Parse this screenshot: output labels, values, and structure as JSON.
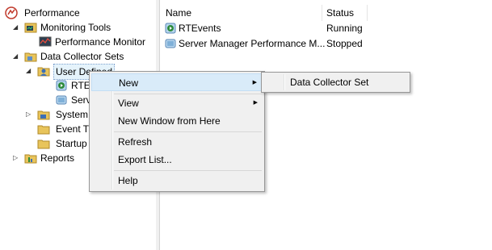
{
  "tree": {
    "performance": "Performance",
    "monitoring_tools": "Monitoring Tools",
    "performance_monitor": "Performance Monitor",
    "data_collector_sets": "Data Collector Sets",
    "user_defined": "User Defined",
    "rtevents_partial": "RTE",
    "server_partial": "Serv",
    "system_partial": "System",
    "event_trace_partial": "Event Tr",
    "startup_partial": "Startup",
    "reports": "Reports"
  },
  "list": {
    "headers": {
      "name": "Name",
      "status": "Status"
    },
    "rows": [
      {
        "name": "RTEvents",
        "status": "Running"
      },
      {
        "name": "Server Manager Performance M...",
        "status": "Stopped"
      }
    ]
  },
  "context_menu": {
    "new": "New",
    "view": "View",
    "new_window": "New Window from Here",
    "refresh": "Refresh",
    "export_list": "Export List...",
    "help": "Help"
  },
  "submenu": {
    "data_collector_set": "Data Collector Set"
  },
  "colors": {
    "highlight": "#d9ebf9",
    "selection": "#e5f3fb",
    "folder": "#e8c45b"
  },
  "icons": {
    "performance": "performance-icon",
    "monitoring": "monitoring-tools-icon",
    "monitor": "performance-monitor-icon",
    "folder": "folder-icon",
    "user": "user-defined-icon",
    "running": "running-set-icon",
    "stopped": "stopped-set-icon",
    "reports": "reports-icon"
  }
}
